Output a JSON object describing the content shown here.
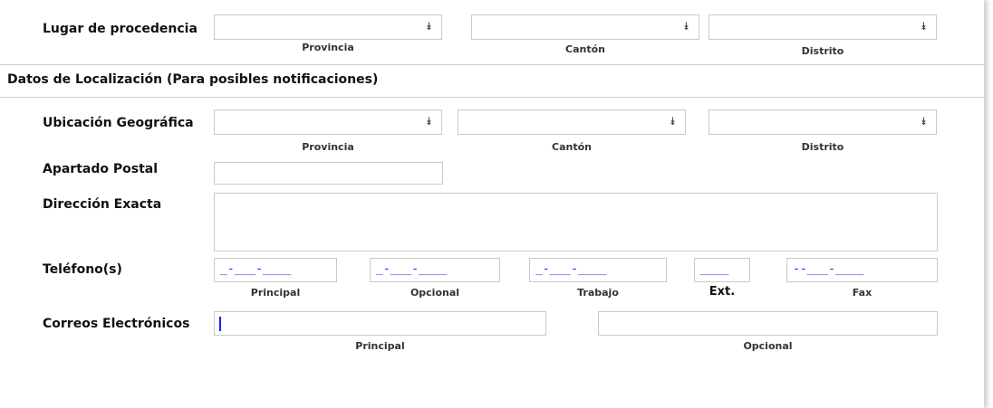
{
  "origin": {
    "label": "Lugar de procedencia",
    "provincia_caption": "Provincia",
    "canton_caption": "Cantón",
    "distrito_caption": "Distrito"
  },
  "section": {
    "title": "Datos de Localización (Para posibles notificaciones)"
  },
  "location": {
    "label": "Ubicación Geográfica",
    "provincia_caption": "Provincia",
    "canton_caption": "Cantón",
    "distrito_caption": "Distrito"
  },
  "postal": {
    "label": "Apartado Postal",
    "value": ""
  },
  "address": {
    "label": "Dirección Exacta",
    "value": ""
  },
  "phones": {
    "label": "Teléfono(s)",
    "principal_caption": "Principal",
    "opcional_caption": "Opcional",
    "trabajo_caption": "Trabajo",
    "ext_caption": "Ext.",
    "fax_caption": "Fax",
    "principal_mask": "_-___-____",
    "opcional_mask": "_-___-____",
    "trabajo_mask": "_-___-____",
    "ext_mask": "____",
    "fax_mask": "--___-____"
  },
  "emails": {
    "label": "Correos Electrónicos",
    "principal_caption": "Principal",
    "opcional_caption": "Opcional",
    "principal_value": "",
    "opcional_value": ""
  },
  "icons": {
    "dropdown_arrow": "chevron-double-down-icon"
  }
}
